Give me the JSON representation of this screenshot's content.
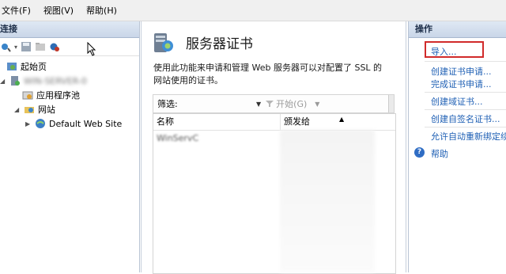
{
  "menubar": {
    "items": [
      "文件(F)",
      "视图(V)",
      "帮助(H)"
    ]
  },
  "left_pane": {
    "title": "连接",
    "tree": [
      {
        "label": "起始页"
      },
      {
        "label": "WIN-SERVER-0"
      },
      {
        "label": "应用程序池"
      },
      {
        "label": "网站"
      },
      {
        "label": "Default Web Site"
      }
    ]
  },
  "center_pane": {
    "title": "服务器证书",
    "description": "使用此功能来申请和管理 Web 服务器可以对配置了 SSL 的网站使用的证书。",
    "filter_label": "筛选:",
    "go_label": "开始(G)",
    "columns": [
      "名称",
      "颁发给"
    ],
    "rows": [
      {
        "name": "WinServC",
        "issued_to": "WIN-SRV"
      }
    ]
  },
  "right_pane": {
    "title": "操作",
    "actions": [
      "导入...",
      "创建证书申请...",
      "完成证书申请...",
      "创建域证书...",
      "创建自签名证书...",
      "允许自动重新绑定续",
      "帮助"
    ]
  },
  "colors": {
    "link": "#1e5fb4",
    "highlight_box": "#d12b2b",
    "pane_header": "#c9d6e8"
  }
}
